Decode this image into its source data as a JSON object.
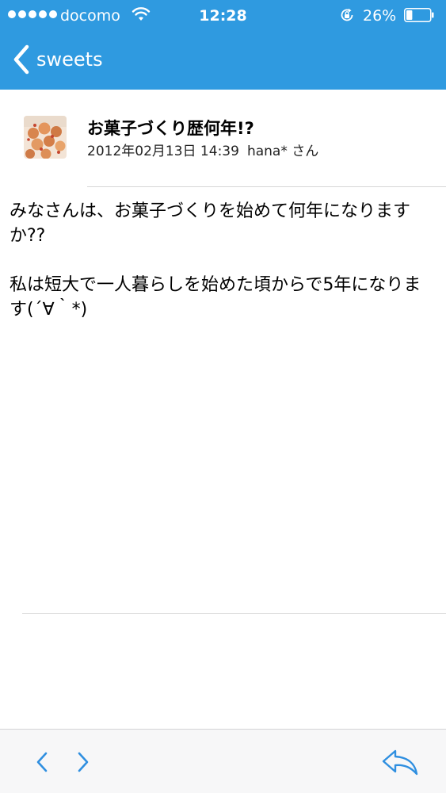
{
  "status_bar": {
    "carrier": "docomo",
    "time": "12:28",
    "battery_percent": "26%",
    "battery_level": 0.26,
    "signal_dots": 5
  },
  "nav": {
    "back_label": "sweets"
  },
  "post": {
    "title": "お菓子づくり歴何年!?",
    "date": "2012年02月13日 14:39",
    "author": "hana* さん",
    "body": [
      "みなさんは、お菓子づくりを始めて何年になりますか??",
      "私は短大で一人暮らしを始めた頃からで5年になります(´∀｀*)"
    ]
  },
  "icons": {
    "back": "chevron-left-icon",
    "prev": "chevron-left-icon",
    "next": "chevron-right-icon",
    "reply": "reply-arrow-icon",
    "wifi": "wifi-icon",
    "lock": "rotation-lock-icon",
    "battery": "battery-icon"
  },
  "colors": {
    "header": "#2f9ae0",
    "accent": "#2f8fe0",
    "toolbar_bg": "#f7f7f8"
  }
}
